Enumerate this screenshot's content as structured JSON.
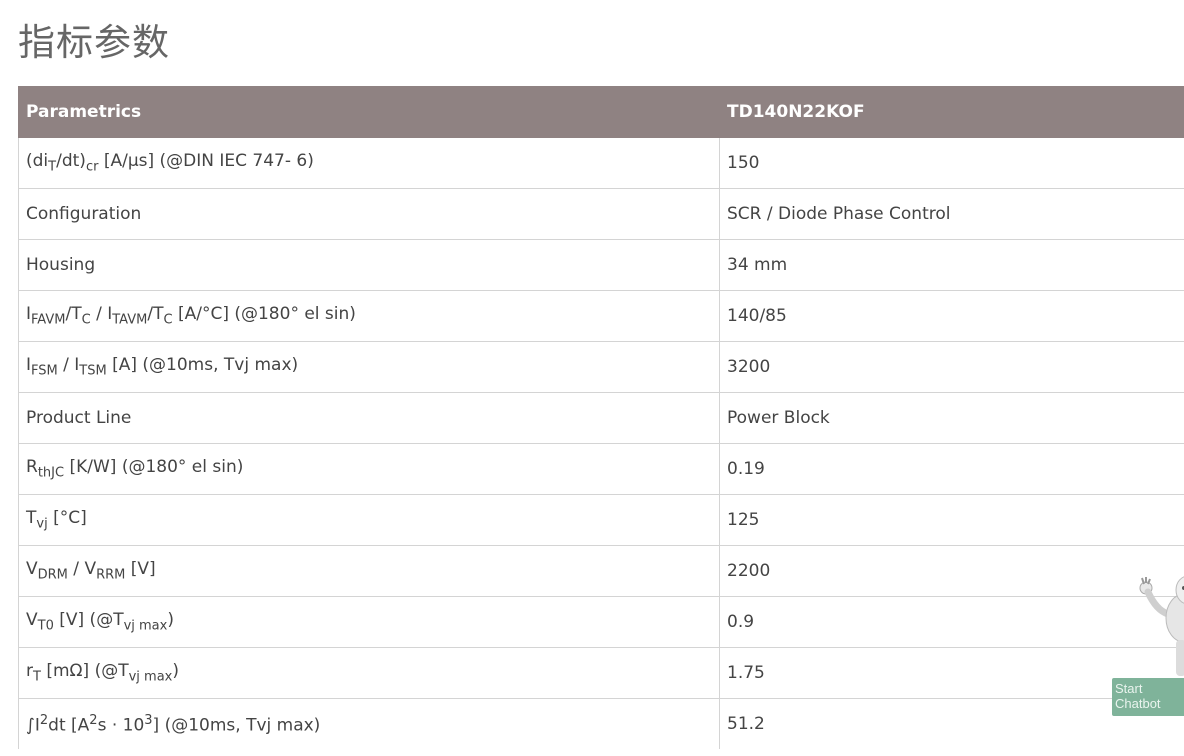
{
  "page": {
    "title": "指标参数"
  },
  "table": {
    "header": {
      "col1": "Parametrics",
      "col2": "TD140N22KOF"
    },
    "rows": [
      {
        "param_id": "dit-dt-cr",
        "value": "150"
      },
      {
        "param_id": "configuration",
        "label": "Configuration",
        "value": "SCR / Diode Phase Control"
      },
      {
        "param_id": "housing",
        "label": "Housing",
        "value": "34 mm"
      },
      {
        "param_id": "ifavm-tc",
        "value": "140/85"
      },
      {
        "param_id": "ifsm-itsm",
        "value": "3200"
      },
      {
        "param_id": "product-line",
        "label": "Product Line",
        "value": "Power Block"
      },
      {
        "param_id": "rthjc",
        "value": "0.19"
      },
      {
        "param_id": "tvj",
        "value": "125"
      },
      {
        "param_id": "vdrm-vrrm",
        "value": "2200"
      },
      {
        "param_id": "vt0",
        "value": "0.9"
      },
      {
        "param_id": "rt",
        "value": "1.75"
      },
      {
        "param_id": "i2dt",
        "value": "51.2"
      }
    ]
  },
  "chatbot": {
    "line1": "Start",
    "line2": "Chatbot"
  }
}
